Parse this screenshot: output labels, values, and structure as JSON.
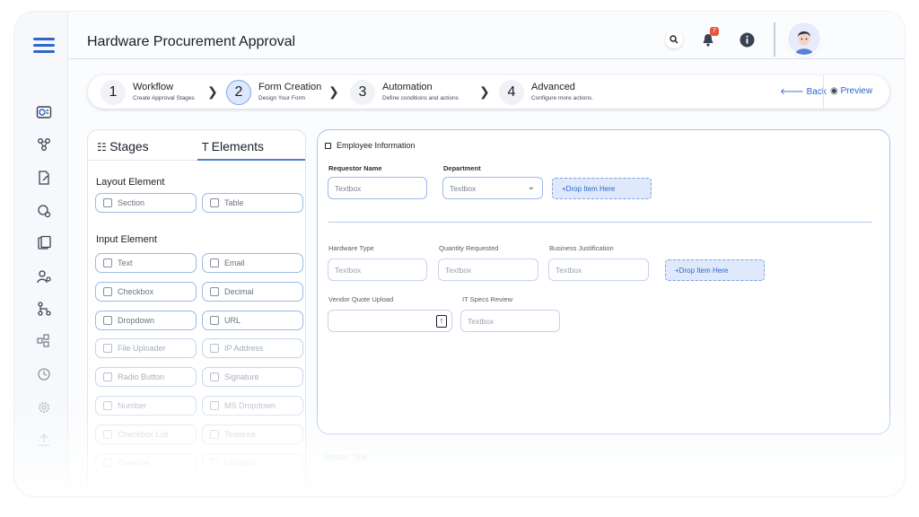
{
  "app": {
    "title": "Hardware Procurement Approval",
    "notification_count": "7"
  },
  "stepper": {
    "steps": [
      {
        "num": "1",
        "label": "Workflow",
        "sub": "Create Approval Stages"
      },
      {
        "num": "2",
        "label": "Form Creation",
        "sub": "Design Your Form"
      },
      {
        "num": "3",
        "label": "Automation",
        "sub": "Define conditions and actions"
      },
      {
        "num": "4",
        "label": "Advanced",
        "sub": "Configure more actions."
      }
    ],
    "back_label": "Back",
    "preview_label": "Preview"
  },
  "left_panel": {
    "tabs": [
      "Stages",
      "Elements"
    ],
    "layout_heading": "Layout Element",
    "layout_items": [
      "Section",
      "Table"
    ],
    "input_heading": "Input Element",
    "input_items": [
      "Text",
      "Email",
      "Checkbox",
      "Decimal",
      "Dropdown",
      "URL",
      "File Uploader",
      "IP Address",
      "Radio Button",
      "Signature",
      "Number",
      "MS Dropdown",
      "Checkbox List",
      "Textarea",
      "Datetime",
      "Location"
    ]
  },
  "form": {
    "section_title": "Employee Information",
    "row1": [
      {
        "label": "Requestor Name",
        "placeholder": "Textbox"
      },
      {
        "label": "Department",
        "placeholder": "Textbox"
      }
    ],
    "drop_label": "+Drop Item Here",
    "row2": [
      {
        "label": "Hardware Type",
        "placeholder": "Textbox"
      },
      {
        "label": "Quantity Requested",
        "placeholder": "Textbox"
      },
      {
        "label": "Business Justification",
        "placeholder": "Textbox"
      }
    ],
    "row3": [
      {
        "label": "Vendor Quote Upload",
        "placeholder": ""
      },
      {
        "label": "IT Specs Review",
        "placeholder": "Textbox"
      }
    ],
    "ghost_section": "Section Title"
  },
  "colors": {
    "accent": "#2f66c7",
    "badge": "#e5573f"
  }
}
